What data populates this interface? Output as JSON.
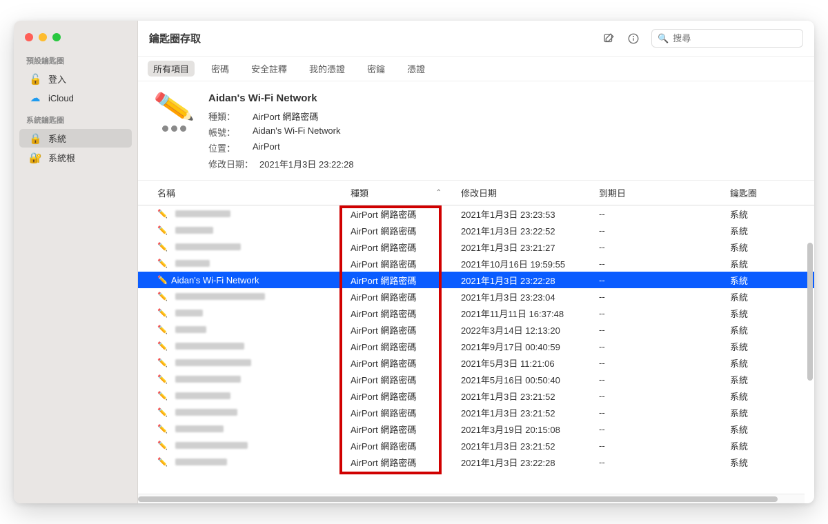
{
  "title": "鑰匙圈存取",
  "search_placeholder": "搜尋",
  "sidebar": {
    "headers": [
      "預設鑰匙圈",
      "系統鑰匙圈"
    ],
    "g1": [
      {
        "icon": "unlock",
        "label": "登入"
      },
      {
        "icon": "cloud",
        "label": "iCloud"
      }
    ],
    "g2": [
      {
        "icon": "lock",
        "label": "系統",
        "selected": true
      },
      {
        "icon": "cert",
        "label": "系統根"
      }
    ]
  },
  "tabs": [
    "所有項目",
    "密碼",
    "安全註釋",
    "我的憑證",
    "密鑰",
    "憑證"
  ],
  "active_tab": 0,
  "detail": {
    "title": "Aidan's Wi-Fi Network",
    "rows": [
      {
        "lbl": "種類：",
        "val": "AirPort 網路密碼"
      },
      {
        "lbl": "帳號：",
        "val": "Aidan's Wi-Fi Network"
      },
      {
        "lbl": "位置：",
        "val": "AirPort"
      },
      {
        "lbl": "修改日期：",
        "val": "2021年1月3日 23:22:28"
      }
    ]
  },
  "columns": [
    "名稱",
    "種類",
    "修改日期",
    "到期日",
    "鑰匙圈"
  ],
  "rows": [
    {
      "name_blur": 80,
      "type": "AirPort 網路密碼",
      "mod": "2021年1月3日 23:23:53",
      "exp": "--",
      "kc": "系統"
    },
    {
      "name_blur": 55,
      "type": "AirPort 網路密碼",
      "mod": "2021年1月3日 23:22:52",
      "exp": "--",
      "kc": "系統"
    },
    {
      "name_blur": 95,
      "type": "AirPort 網路密碼",
      "mod": "2021年1月3日 23:21:27",
      "exp": "--",
      "kc": "系統"
    },
    {
      "name_blur": 50,
      "type": "AirPort 網路密碼",
      "mod": "2021年10月16日 19:59:55",
      "exp": "--",
      "kc": "系統"
    },
    {
      "name": "Aidan's Wi-Fi Network",
      "type": "AirPort 網路密碼",
      "mod": "2021年1月3日 23:22:28",
      "exp": "--",
      "kc": "系統",
      "selected": true
    },
    {
      "name_blur": 130,
      "type": "AirPort 網路密碼",
      "mod": "2021年1月3日 23:23:04",
      "exp": "--",
      "kc": "系統"
    },
    {
      "name_blur": 40,
      "type": "AirPort 網路密碼",
      "mod": "2021年11月11日 16:37:48",
      "exp": "--",
      "kc": "系統"
    },
    {
      "name_blur": 45,
      "type": "AirPort 網路密碼",
      "mod": "2022年3月14日 12:13:20",
      "exp": "--",
      "kc": "系統"
    },
    {
      "name_blur": 100,
      "type": "AirPort 網路密碼",
      "mod": "2021年9月17日 00:40:59",
      "exp": "--",
      "kc": "系統"
    },
    {
      "name_blur": 110,
      "type": "AirPort 網路密碼",
      "mod": "2021年5月3日 11:21:06",
      "exp": "--",
      "kc": "系統"
    },
    {
      "name_blur": 95,
      "type": "AirPort 網路密碼",
      "mod": "2021年5月16日 00:50:40",
      "exp": "--",
      "kc": "系統"
    },
    {
      "name_blur": 80,
      "type": "AirPort 網路密碼",
      "mod": "2021年1月3日 23:21:52",
      "exp": "--",
      "kc": "系統"
    },
    {
      "name_blur": 90,
      "type": "AirPort 網路密碼",
      "mod": "2021年1月3日 23:21:52",
      "exp": "--",
      "kc": "系統"
    },
    {
      "name_blur": 70,
      "type": "AirPort 網路密碼",
      "mod": "2021年3月19日 20:15:08",
      "exp": "--",
      "kc": "系統"
    },
    {
      "name_blur": 105,
      "type": "AirPort 網路密碼",
      "mod": "2021年1月3日 23:21:52",
      "exp": "--",
      "kc": "系統"
    },
    {
      "name_blur": 75,
      "type": "AirPort 網路密碼",
      "mod": "2021年1月3日 23:22:28",
      "exp": "--",
      "kc": "系統"
    }
  ]
}
